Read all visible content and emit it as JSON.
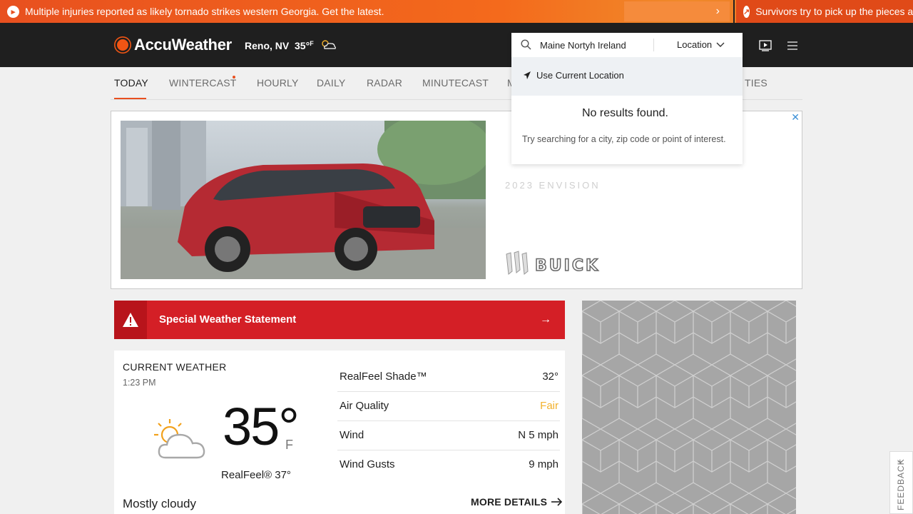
{
  "ticker": {
    "headline": "Multiple injuries reported as likely tornado strikes western Georgia. Get the latest.",
    "next_label": "›",
    "second_headline": "Survivors try to pick up the pieces aft"
  },
  "header": {
    "logo_text": "AccuWeather",
    "location": "Reno, NV",
    "temp": "35°",
    "temp_unit": "F"
  },
  "search": {
    "value": "Maine Nortyh Ireland",
    "type_label": "Location",
    "use_current_label": "Use Current Location",
    "no_results": "No results found.",
    "hint": "Try searching for a city, zip code or point of interest."
  },
  "nav": {
    "tabs": [
      {
        "label": "TODAY",
        "active": true
      },
      {
        "label": "WINTERCAST"
      },
      {
        "label": "HOURLY"
      },
      {
        "label": "DAILY"
      },
      {
        "label": "RADAR"
      },
      {
        "label": "MINUTECAST"
      },
      {
        "label": "M"
      },
      {
        "label": "TIES"
      }
    ]
  },
  "ad": {
    "close": "✕",
    "model_text": "2023 ENVISION",
    "brand_text": "BUICK"
  },
  "alert": {
    "title": "Special Weather Statement",
    "arrow": "→"
  },
  "current_weather": {
    "title": "CURRENT WEATHER",
    "time": "1:23 PM",
    "temp": "35°",
    "unit": "F",
    "realfeel": "RealFeel® 37°",
    "phrase": "Mostly cloudy",
    "details": [
      {
        "label": "RealFeel Shade™",
        "value": "32°"
      },
      {
        "label": "Air Quality",
        "value": "Fair",
        "color": "#f2b12c"
      },
      {
        "label": "Wind",
        "value": "N 5 mph"
      },
      {
        "label": "Wind Gusts",
        "value": "9 mph"
      }
    ],
    "more_details": "MORE DETAILS"
  },
  "feedback": {
    "label": "FEEDBACK",
    "plus": "+"
  },
  "colors": {
    "accent": "#e8501f",
    "alert": "#d41f26",
    "header_bg": "#1f1f1f"
  }
}
